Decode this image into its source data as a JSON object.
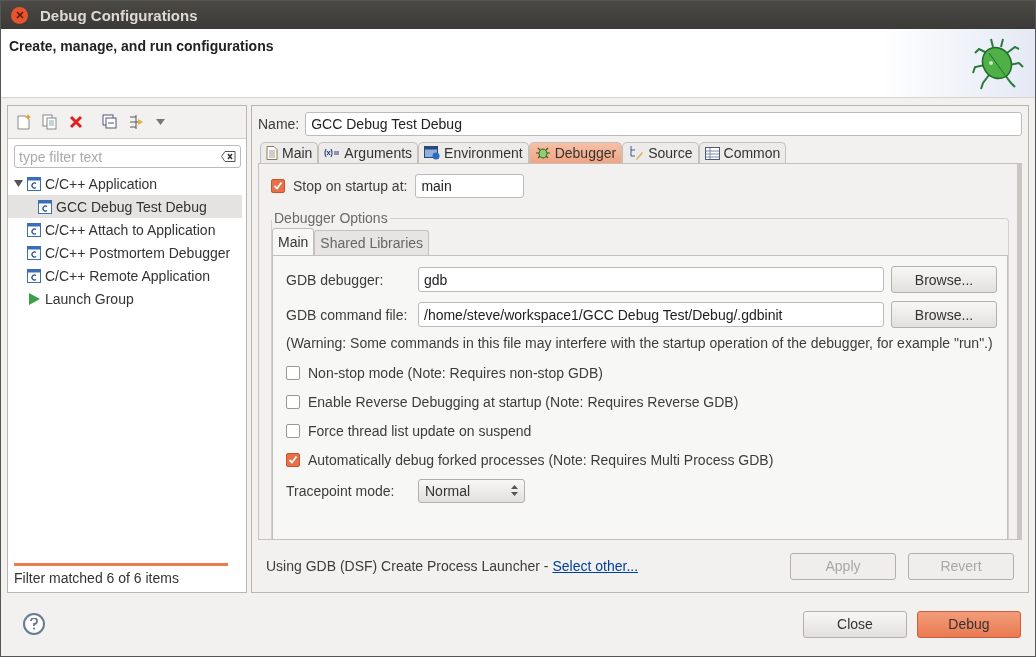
{
  "window": {
    "title": "Debug Configurations"
  },
  "header": {
    "title": "Create, manage, and run configurations"
  },
  "sidebar": {
    "filter": {
      "placeholder": "type filter text"
    },
    "tree": [
      {
        "label": "C/C++ Application",
        "kind": "c",
        "expanded": true,
        "selected": false,
        "children": [
          {
            "label": "GCC Debug Test Debug",
            "kind": "c",
            "selected": true
          }
        ]
      },
      {
        "label": "C/C++ Attach to Application",
        "kind": "c",
        "selected": false
      },
      {
        "label": "C/C++ Postmortem Debugger",
        "kind": "c",
        "selected": false
      },
      {
        "label": "C/C++ Remote Application",
        "kind": "c",
        "selected": false
      },
      {
        "label": "Launch Group",
        "kind": "launch",
        "selected": false
      }
    ],
    "status": "Filter matched 6 of 6 items"
  },
  "name_field": {
    "label": "Name:",
    "value": "GCC Debug Test Debug"
  },
  "tabs": [
    {
      "label": "Main",
      "kind": "doc",
      "selected": false
    },
    {
      "label": "Arguments",
      "kind": "args",
      "selected": false
    },
    {
      "label": "Environment",
      "kind": "env",
      "selected": false
    },
    {
      "label": "Debugger",
      "kind": "bug",
      "selected": true
    },
    {
      "label": "Source",
      "kind": "source",
      "selected": false
    },
    {
      "label": "Common",
      "kind": "table",
      "selected": false
    }
  ],
  "stop_on_startup": {
    "label": "Stop on startup at:",
    "checked": true,
    "value": "main"
  },
  "debugger_options": {
    "title": "Debugger Options",
    "tabs": [
      {
        "label": "Main",
        "selected": true
      },
      {
        "label": "Shared Libraries",
        "selected": false
      }
    ],
    "fields": [
      {
        "label": "GDB debugger:",
        "value": "gdb",
        "button": "Browse..."
      },
      {
        "label": "GDB command file:",
        "value": "/home/steve/workspace1/GCC Debug Test/Debug/.gdbinit",
        "button": "Browse..."
      }
    ],
    "warning": "(Warning: Some commands in this file may interfere with the startup operation of the debugger, for example \"run\".)",
    "options": [
      {
        "label": "Non-stop mode (Note: Requires non-stop GDB)",
        "checked": false
      },
      {
        "label": "Enable Reverse Debugging at startup (Note: Requires Reverse GDB)",
        "checked": false
      },
      {
        "label": "Force thread list update on suspend",
        "checked": false
      },
      {
        "label": "Automatically debug forked processes (Note: Requires Multi Process GDB)",
        "checked": true
      }
    ],
    "tracepoint": {
      "label": "Tracepoint mode:",
      "value": "Normal"
    }
  },
  "launcher": {
    "text": "Using GDB (DSF) Create Process Launcher -",
    "link": "Select other..."
  },
  "page_buttons": [
    {
      "label": "Apply",
      "disabled": true
    },
    {
      "label": "Revert",
      "disabled": true
    }
  ],
  "dialog_buttons": [
    {
      "label": "Close",
      "default": false
    },
    {
      "label": "Debug",
      "default": true
    }
  ]
}
